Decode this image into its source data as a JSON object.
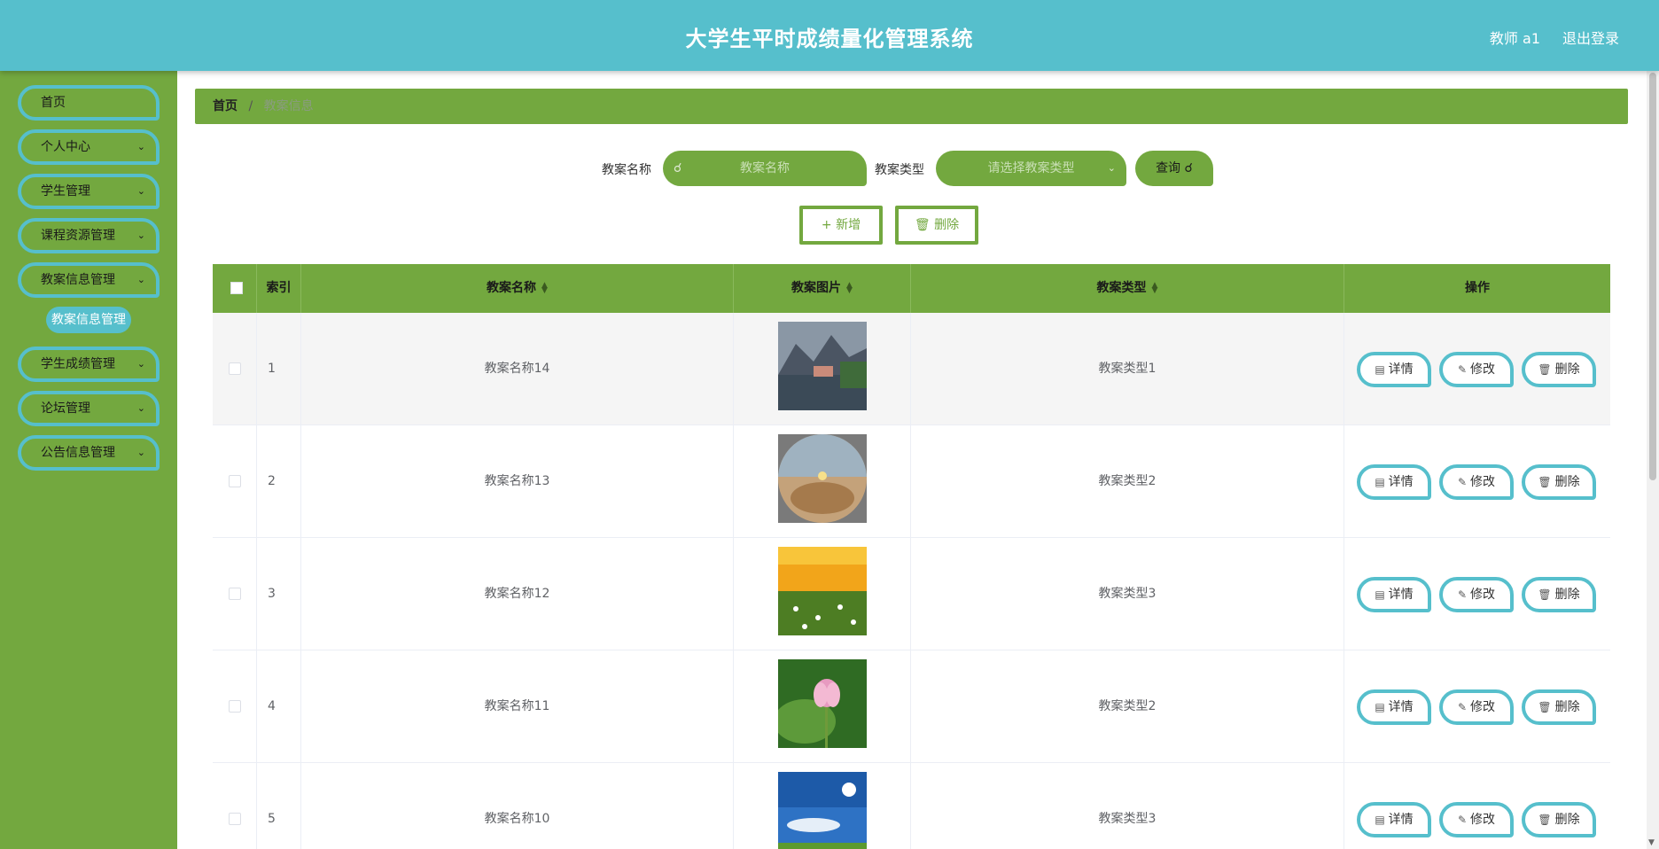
{
  "header": {
    "title": "大学生平时成绩量化管理系统",
    "user": "教师 a1",
    "logout": "退出登录"
  },
  "sidebar": {
    "items": [
      {
        "label": "首页"
      },
      {
        "label": "个人中心"
      },
      {
        "label": "学生管理"
      },
      {
        "label": "课程资源管理"
      },
      {
        "label": "教案信息管理"
      },
      {
        "label": "学生成绩管理"
      },
      {
        "label": "论坛管理"
      },
      {
        "label": "公告信息管理"
      }
    ],
    "sub_item": "教案信息管理"
  },
  "breadcrumb": {
    "home": "首页",
    "sep": "/",
    "current": "教案信息"
  },
  "search": {
    "name_label": "教案名称",
    "name_placeholder": "教案名称",
    "type_label": "教案类型",
    "type_placeholder": "请选择教案类型",
    "query": "查询"
  },
  "actions": {
    "add": "新增",
    "delete": "删除"
  },
  "table": {
    "headers": [
      "索引",
      "教案名称",
      "教案图片",
      "教案类型",
      "操作"
    ],
    "rows": [
      {
        "index": "1",
        "name": "教案名称14",
        "type": "教案类型1"
      },
      {
        "index": "2",
        "name": "教案名称13",
        "type": "教案类型2"
      },
      {
        "index": "3",
        "name": "教案名称12",
        "type": "教案类型3"
      },
      {
        "index": "4",
        "name": "教案名称11",
        "type": "教案类型2"
      },
      {
        "index": "5",
        "name": "教案名称10",
        "type": "教案类型3"
      }
    ],
    "row_actions": {
      "detail": "详情",
      "edit": "修改",
      "delete": "删除"
    }
  },
  "colors": {
    "primary_green": "#73a83f",
    "accent_teal": "#56bfcc"
  }
}
